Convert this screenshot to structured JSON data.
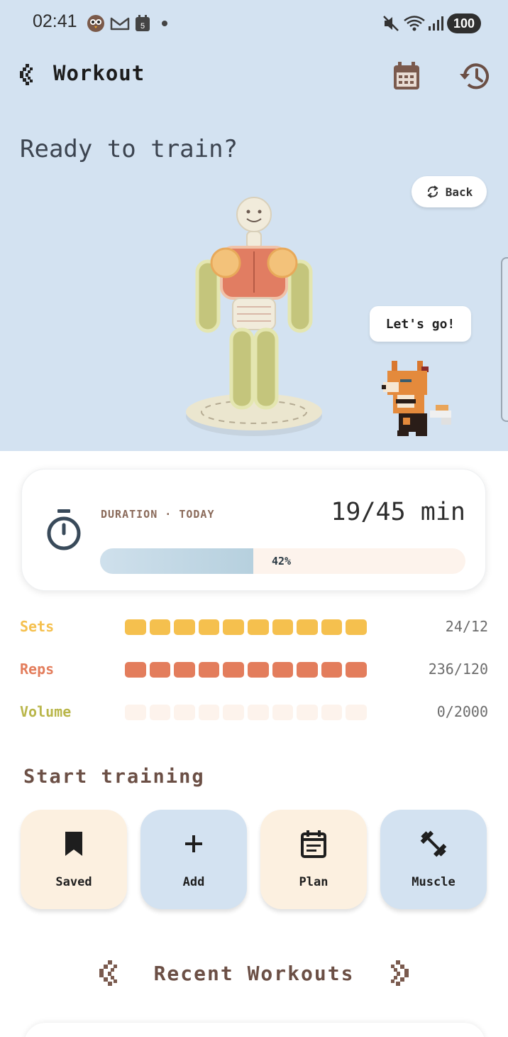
{
  "status_bar": {
    "time": "02:41",
    "battery": "100"
  },
  "header": {
    "title": "Workout"
  },
  "hero": {
    "greeting": "Ready to train?",
    "back_label": "Back",
    "speech": "Let's go!"
  },
  "duration": {
    "label": "DURATION · TODAY",
    "value": "19/45 min",
    "progress_label": "42%",
    "progress_fraction": 0.42
  },
  "stats": [
    {
      "name": "Sets",
      "value": "24/12",
      "filled": 10,
      "color": "#f5c04e"
    },
    {
      "name": "Reps",
      "value": "236/120",
      "filled": 10,
      "color": "#e37d5c"
    },
    {
      "name": "Volume",
      "value": "0/2000",
      "filled": 0,
      "color": "#b9b64a"
    }
  ],
  "colors": {
    "hero_bg": "#d3e2f1",
    "empty_block": "#fdf3ec",
    "tile_cream": "#fcf0e0",
    "tile_blue": "#d3e2f1",
    "title_brown": "#6b4f45"
  },
  "start_training": {
    "title": "Start training",
    "tiles": [
      {
        "label": "Saved",
        "icon": "bookmark-icon"
      },
      {
        "label": "Add",
        "icon": "plus-icon"
      },
      {
        "label": "Plan",
        "icon": "clipboard-icon"
      },
      {
        "label": "Muscle",
        "icon": "dumbbell-icon"
      }
    ]
  },
  "recent": {
    "title": "Recent Workouts"
  }
}
